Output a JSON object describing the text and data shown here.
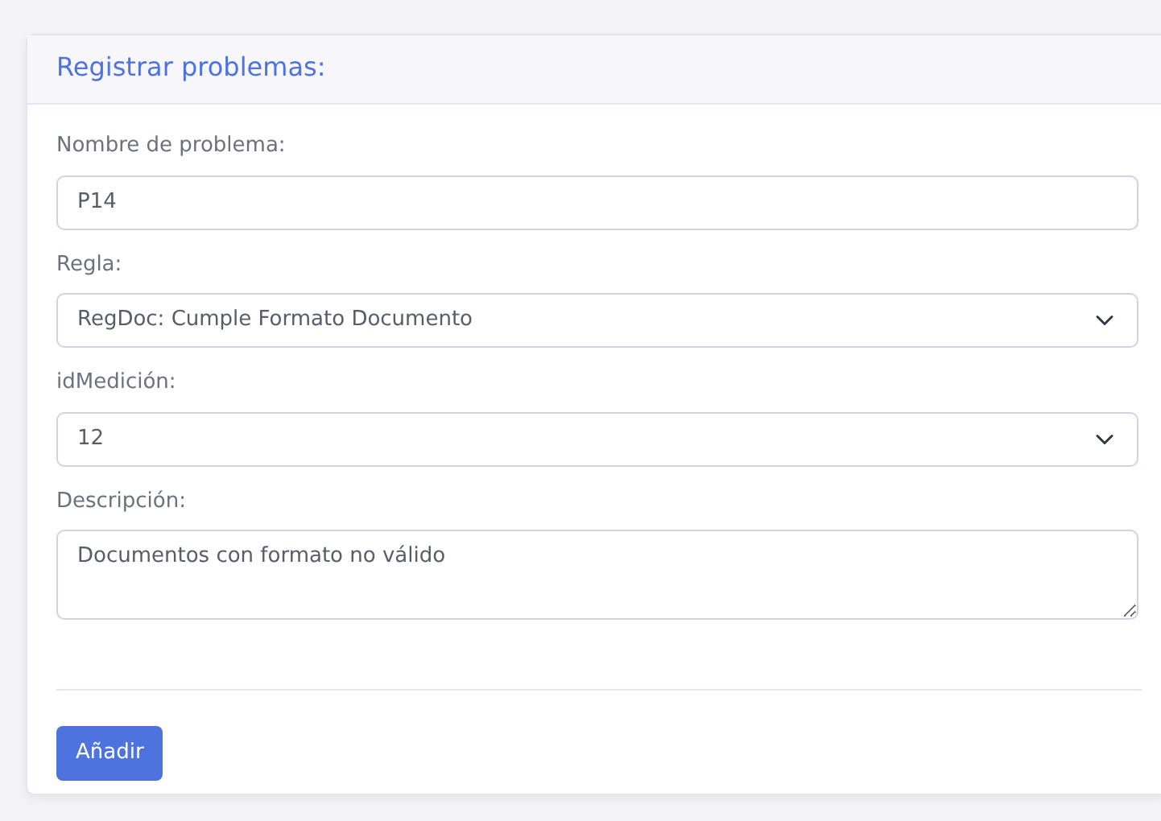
{
  "card": {
    "title": "Registrar problemas:"
  },
  "fields": [
    {
      "kind": "input",
      "label": "Nombre de problema:",
      "value": "P14"
    },
    {
      "kind": "select",
      "label": "Regla:",
      "value": "RegDoc: Cumple Formato Documento"
    },
    {
      "kind": "select",
      "label": "idMedición:",
      "value": "12"
    },
    {
      "kind": "textarea",
      "label": "Descripción:",
      "value": "Documentos con formato no válido"
    }
  ],
  "submit_button": "Añadir"
}
